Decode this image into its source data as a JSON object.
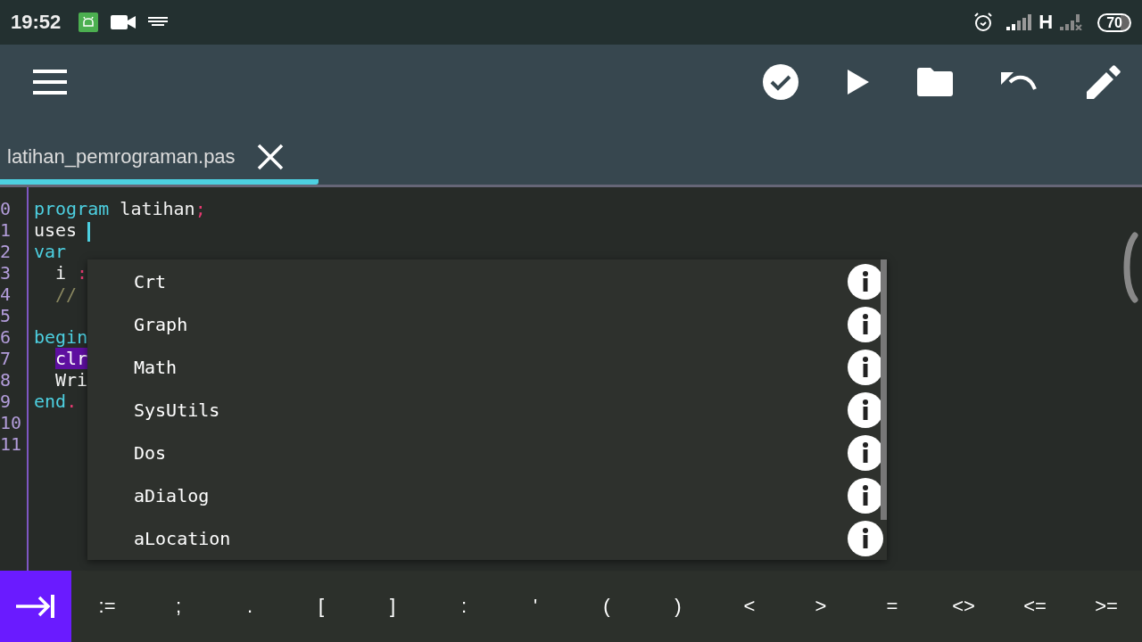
{
  "status_bar": {
    "time": "19:52",
    "network_type": "H",
    "battery": "70"
  },
  "tabs": [
    {
      "label": "latihan_pemrograman.pas",
      "selected": true
    }
  ],
  "editor": {
    "lines": [
      {
        "number": "0",
        "indented": false,
        "tokens": [
          {
            "kind": "keyword",
            "text": "program"
          },
          {
            "kind": "plain",
            "text": " latihan"
          },
          {
            "kind": "punct",
            "text": ";"
          }
        ]
      },
      {
        "number": "1",
        "indented": false,
        "tokens": [
          {
            "kind": "plain",
            "text": "uses "
          },
          {
            "kind": "cursor"
          }
        ]
      },
      {
        "number": "2",
        "indented": false,
        "tokens": [
          {
            "kind": "keyword",
            "text": "var"
          }
        ]
      },
      {
        "number": "3",
        "indented": true,
        "tokens": [
          {
            "kind": "plain",
            "text": "i "
          },
          {
            "kind": "punct",
            "text": ":"
          }
        ]
      },
      {
        "number": "4",
        "indented": true,
        "tokens": [
          {
            "kind": "comment",
            "text": "//"
          }
        ]
      },
      {
        "number": "5",
        "indented": false
      },
      {
        "number": "6",
        "indented": false,
        "tokens": [
          {
            "kind": "keyword",
            "text": "begin"
          }
        ]
      },
      {
        "number": "7",
        "indented": true,
        "tokens": [
          {
            "kind": "highlight",
            "text": "clr"
          }
        ]
      },
      {
        "number": "8",
        "indented": true,
        "tokens": [
          {
            "kind": "plain",
            "text": "Wri"
          }
        ]
      },
      {
        "number": "9",
        "indented": false,
        "tokens": [
          {
            "kind": "keyword",
            "text": "end"
          },
          {
            "kind": "punct",
            "text": "."
          }
        ]
      },
      {
        "number": "10",
        "indented": false
      },
      {
        "number": "11",
        "indented": false
      }
    ]
  },
  "autocomplete": {
    "items": [
      {
        "label": "Crt"
      },
      {
        "label": "Graph"
      },
      {
        "label": "Math"
      },
      {
        "label": "SysUtils"
      },
      {
        "label": "Dos"
      },
      {
        "label": "aDialog"
      },
      {
        "label": "aLocation"
      }
    ]
  },
  "symbol_keys": [
    ":=",
    ";",
    ".",
    "[",
    "]",
    ":",
    "'",
    "(",
    ")",
    "<",
    ">",
    "=",
    "<>",
    "<=",
    ">="
  ]
}
